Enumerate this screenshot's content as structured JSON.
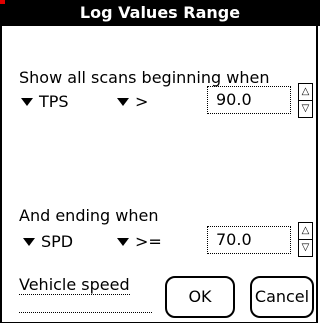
{
  "title": "Log Values Range",
  "begin": {
    "label": "Show all scans beginning when",
    "field": "TPS",
    "operator": ">",
    "value": "90.0"
  },
  "end": {
    "label": "And ending when",
    "field": "SPD",
    "operator": ">=",
    "value": "70.0"
  },
  "footer": {
    "field_label": "Vehicle speed",
    "ok_label": "OK",
    "cancel_label": "Cancel"
  },
  "icons": {
    "dropdown": "triangle-down",
    "spin_up": "up-arrow",
    "spin_down": "down-arrow"
  }
}
